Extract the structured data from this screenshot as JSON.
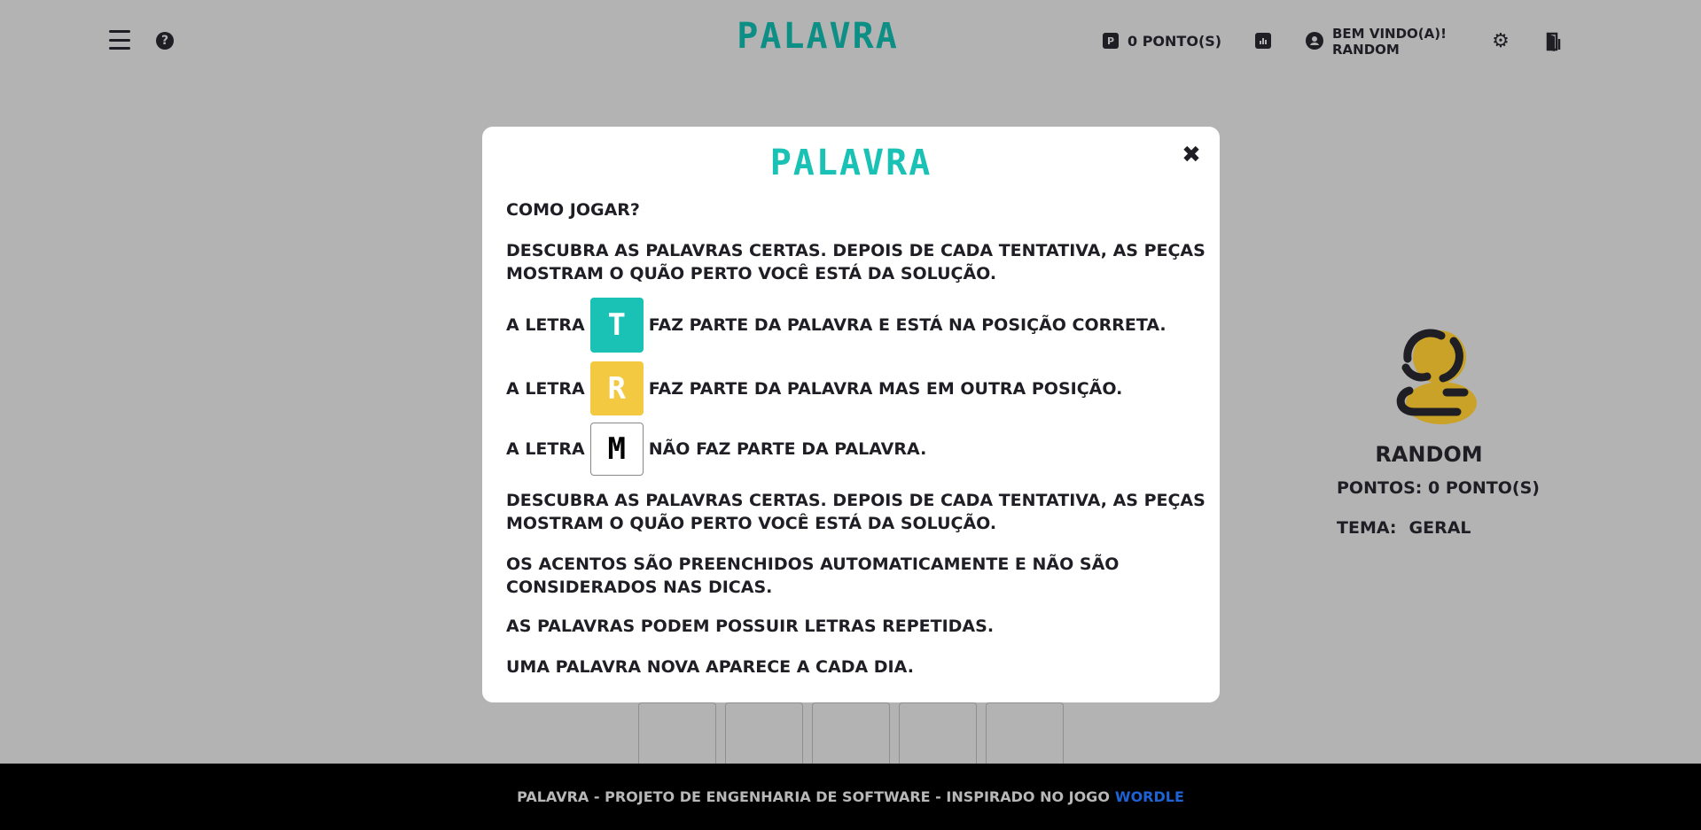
{
  "header": {
    "title": "PALAVRA",
    "points_badge": "P",
    "points_label": "0 PONTO(S)",
    "welcome_line1": "BEM VINDO(A)!",
    "welcome_line2": "RANDOM"
  },
  "profile": {
    "name": "RANDOM",
    "points": "PONTOS: 0 PONTO(S)",
    "theme_label": "TEMA:",
    "theme_value": "GERAL"
  },
  "modal": {
    "title": "PALAVRA",
    "close": "✖",
    "how_to": "COMO JOGAR?",
    "intro_line1": "DESCUBRA AS PALAVRAS CERTAS. DEPOIS DE CADA TENTATIVA, AS PEÇAS",
    "intro_line2": "MOSTRAM O QUÃO PERTO VOCÊ ESTÁ DA SOLUÇÃO.",
    "examples": [
      {
        "prefix": "A LETRA",
        "letter": "T",
        "state": "correct",
        "text": "FAZ PARTE DA PALAVRA E ESTÁ NA POSIÇÃO CORRETA."
      },
      {
        "prefix": "A LETRA",
        "letter": "R",
        "state": "present",
        "text": "FAZ PARTE DA PALAVRA MAS EM OUTRA POSIÇÃO."
      },
      {
        "prefix": "A LETRA",
        "letter": "M",
        "state": "absent",
        "text": "NÃO FAZ PARTE DA PALAVRA."
      }
    ],
    "repeat_line1": "DESCUBRA AS PALAVRAS CERTAS. DEPOIS DE CADA TENTATIVA, AS PEÇAS",
    "repeat_line2": "MOSTRAM O QUÃO PERTO VOCÊ ESTÁ DA SOLUÇÃO.",
    "accents_line1": "OS ACENTOS SÃO PREENCHIDOS AUTOMATICAMENTE E NÃO SÃO",
    "accents_line2": "CONSIDERADOS NAS DICAS.",
    "repeated_letters": "AS PALAVRAS PODEM POSSUIR LETRAS REPETIDAS.",
    "daily": "UMA PALAVRA NOVA APARECE A CADA DIA."
  },
  "footer": {
    "text": "PALAVRA - PROJETO DE ENGENHARIA DE SOFTWARE - INSPIRADO NO JOGO",
    "link": "WORDLE"
  },
  "colors": {
    "correct": "#19c2b4",
    "present": "#f2c940",
    "brand": "#0e8f86",
    "link": "#1e63d6"
  },
  "icons": [
    "hamburger-menu-icon",
    "help-icon",
    "points-icon",
    "stats-icon",
    "user-icon",
    "gear-icon",
    "logout-icon",
    "close-icon"
  ]
}
